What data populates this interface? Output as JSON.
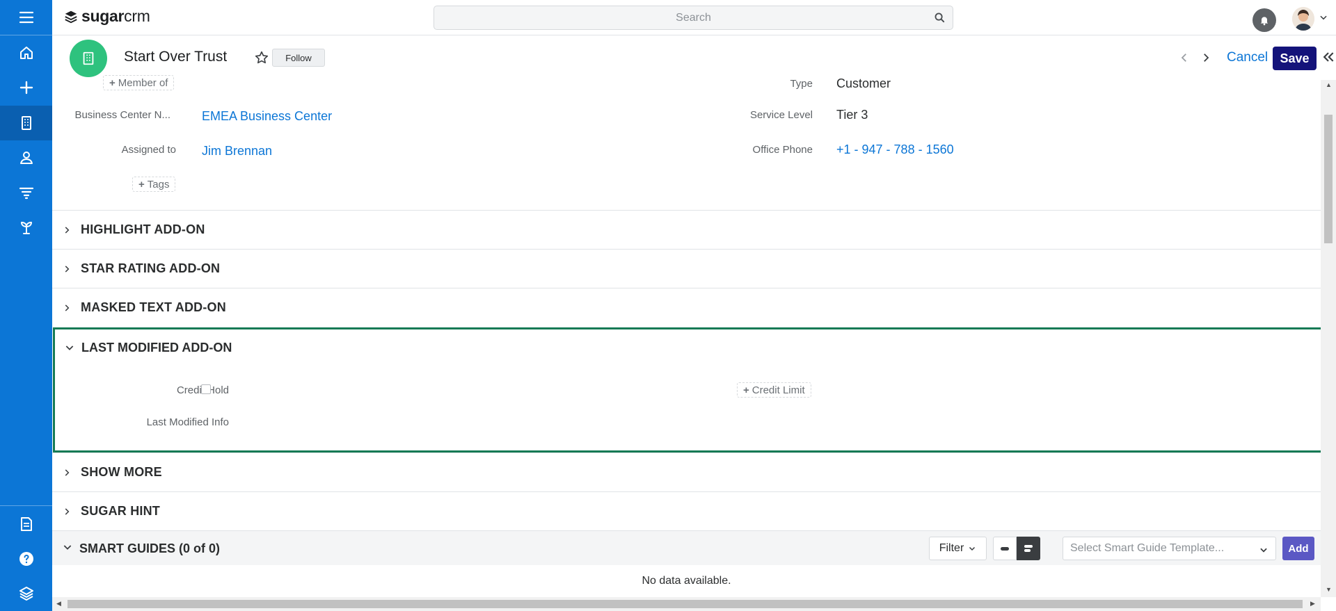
{
  "app": {
    "logo_bold": "sugar",
    "logo_light": "crm"
  },
  "search": {
    "placeholder": "Search"
  },
  "sidebar": {
    "items": [
      {
        "icon": "hamburger-menu-icon"
      },
      {
        "icon": "home-icon"
      },
      {
        "icon": "plus-icon"
      },
      {
        "icon": "building-icon"
      },
      {
        "icon": "person-icon"
      },
      {
        "icon": "filter-funnel-icon"
      },
      {
        "icon": "plant-icon"
      },
      {
        "icon": "document-icon"
      },
      {
        "icon": "help-icon"
      },
      {
        "icon": "layers-icon"
      }
    ]
  },
  "record": {
    "title": "Start Over Trust",
    "follow_label": "Follow",
    "cancel_label": "Cancel",
    "save_label": "Save"
  },
  "fields": {
    "member_of": "Member of",
    "business_center_label": "Business Center N...",
    "business_center_value": "EMEA Business Center",
    "assigned_to_label": "Assigned to",
    "assigned_to_value": "Jim Brennan",
    "tags": "Tags",
    "type_label": "Type",
    "type_value": "Customer",
    "service_level_label": "Service Level",
    "service_level_value": "Tier 3",
    "office_phone_label": "Office Phone",
    "office_phone_value": "+1 - 947 - 788 - 1560"
  },
  "panels": {
    "highlight": "HIGHLIGHT ADD-ON",
    "star_rating": "STAR RATING ADD-ON",
    "masked_text": "MASKED TEXT ADD-ON",
    "last_modified": "LAST MODIFIED ADD-ON",
    "show_more": "SHOW MORE",
    "sugar_hint": "SUGAR HINT"
  },
  "last_modified_panel": {
    "credit_hold_label": "Credit Hold",
    "credit_hold_checked": false,
    "credit_limit": "Credit Limit",
    "last_modified_info_label": "Last Modified Info"
  },
  "smart_guides": {
    "title": "SMART GUIDES (0 of 0)",
    "filter_label": "Filter",
    "template_placeholder": "Select Smart Guide Template...",
    "add_label": "Add",
    "empty_text": "No data available."
  },
  "colors": {
    "sidebar": "#0c76d6",
    "save_button": "#14137a",
    "record_icon": "#2ec27e",
    "focused_panel_border": "#157a55",
    "link": "#0c76d6"
  }
}
